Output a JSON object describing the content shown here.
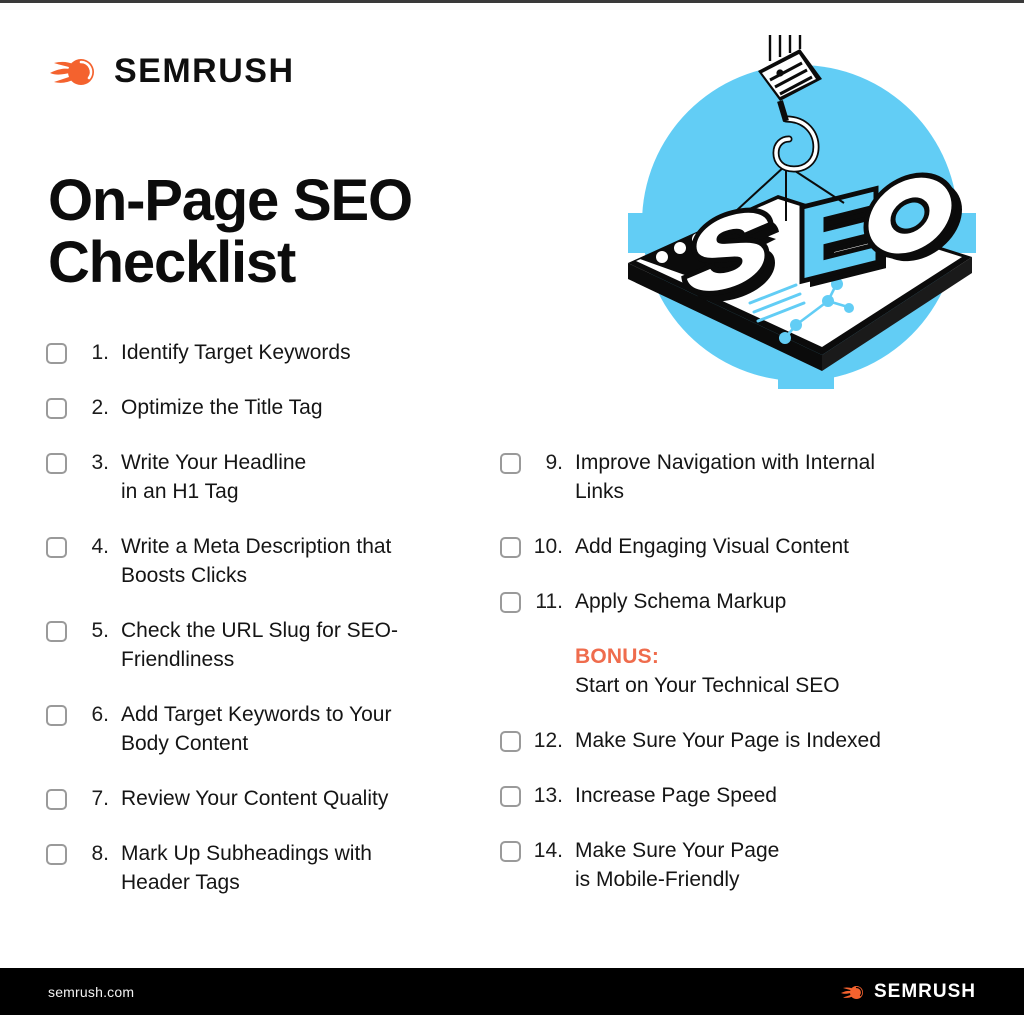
{
  "brand": {
    "name": "SEMRUSH",
    "icon": "semrush-comet-icon",
    "accent_orange": "#F4622E"
  },
  "title": "On-Page SEO\nChecklist",
  "hero": {
    "icon": "seo-crane-hook-laptop-illustration",
    "word": "SEO",
    "background_color": "#62CDF5"
  },
  "colors": {
    "cyan": "#62CDF5",
    "orange": "#EF6C4D",
    "black": "#000000",
    "checkbox_border": "#9A9A9A"
  },
  "checklist": {
    "left": [
      {
        "num": "1.",
        "text": "Identify Target Keywords"
      },
      {
        "num": "2.",
        "text": "Optimize the Title Tag"
      },
      {
        "num": "3.",
        "text": "Write Your Headline\nin an H1 Tag"
      },
      {
        "num": "4.",
        "text": "Write a Meta Description that\nBoosts Clicks"
      },
      {
        "num": "5.",
        "text": "Check the URL Slug for SEO-\nFriendliness"
      },
      {
        "num": "6.",
        "text": "Add Target Keywords to Your\nBody Content"
      },
      {
        "num": "7.",
        "text": "Review Your Content Quality"
      },
      {
        "num": "8.",
        "text": "Mark Up Subheadings with\nHeader Tags"
      }
    ],
    "right_top": [
      {
        "num": "9.",
        "text": "Improve Navigation with Internal\nLinks"
      },
      {
        "num": "10.",
        "text": "Add Engaging Visual Content"
      },
      {
        "num": "11.",
        "text": "Apply Schema Markup"
      }
    ],
    "bonus": {
      "label": "BONUS:",
      "subtitle": "Start on Your Technical SEO"
    },
    "right_bottom": [
      {
        "num": "12.",
        "text": "Make Sure Your Page is Indexed"
      },
      {
        "num": "13.",
        "text": "Increase Page Speed"
      },
      {
        "num": "14.",
        "text": "Make Sure Your Page\nis Mobile-Friendly"
      }
    ]
  },
  "footer": {
    "url": "semrush.com",
    "brand": "SEMRUSH",
    "icon": "semrush-comet-icon"
  }
}
